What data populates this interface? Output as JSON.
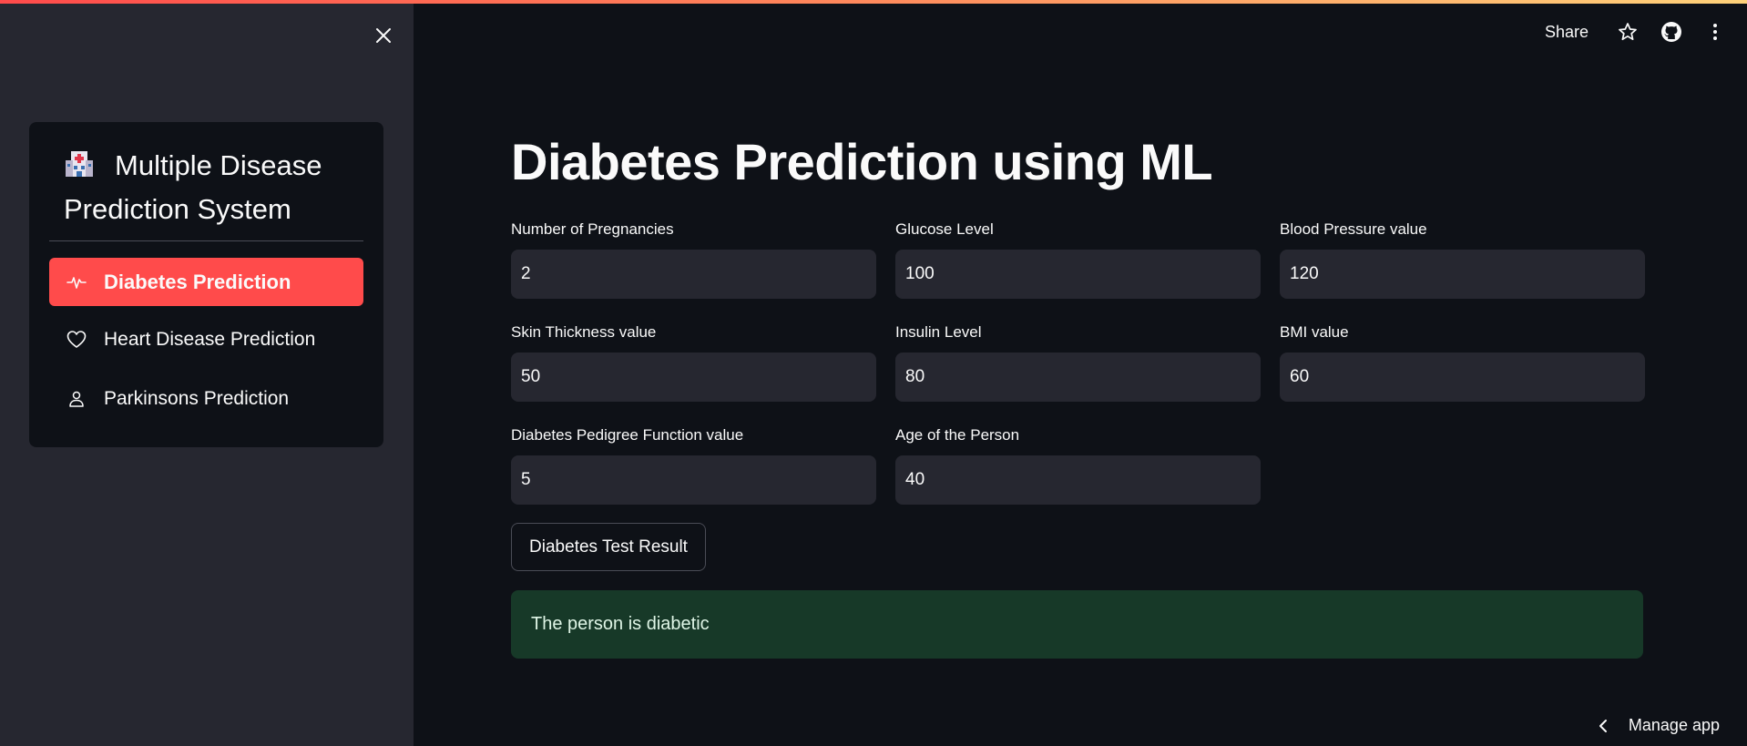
{
  "sidebar": {
    "menu_title": "Multiple Disease Prediction System",
    "items": [
      {
        "label": "Diabetes Prediction",
        "icon": "activity-icon",
        "active": true
      },
      {
        "label": "Heart Disease Prediction",
        "icon": "heart-icon",
        "active": false
      },
      {
        "label": "Parkinsons Prediction",
        "icon": "person-icon",
        "active": false
      }
    ]
  },
  "header": {
    "share_label": "Share"
  },
  "main": {
    "title": "Diabetes Prediction using ML",
    "fields": [
      {
        "label": "Number of Pregnancies",
        "value": "2"
      },
      {
        "label": "Glucose Level",
        "value": "100"
      },
      {
        "label": "Blood Pressure value",
        "value": "120"
      },
      {
        "label": "Skin Thickness value",
        "value": "50"
      },
      {
        "label": "Insulin Level",
        "value": "80"
      },
      {
        "label": "BMI value",
        "value": "60"
      },
      {
        "label": "Diabetes Pedigree Function value",
        "value": "5"
      },
      {
        "label": "Age of the Person",
        "value": "40"
      }
    ],
    "button_label": "Diabetes Test Result",
    "result": "The person is diabetic"
  },
  "footer": {
    "manage_app_label": "Manage app"
  },
  "colors": {
    "accent": "#ff4b4b",
    "background": "#0e1117",
    "sidebar": "#262730",
    "success_bg": "#173928"
  }
}
